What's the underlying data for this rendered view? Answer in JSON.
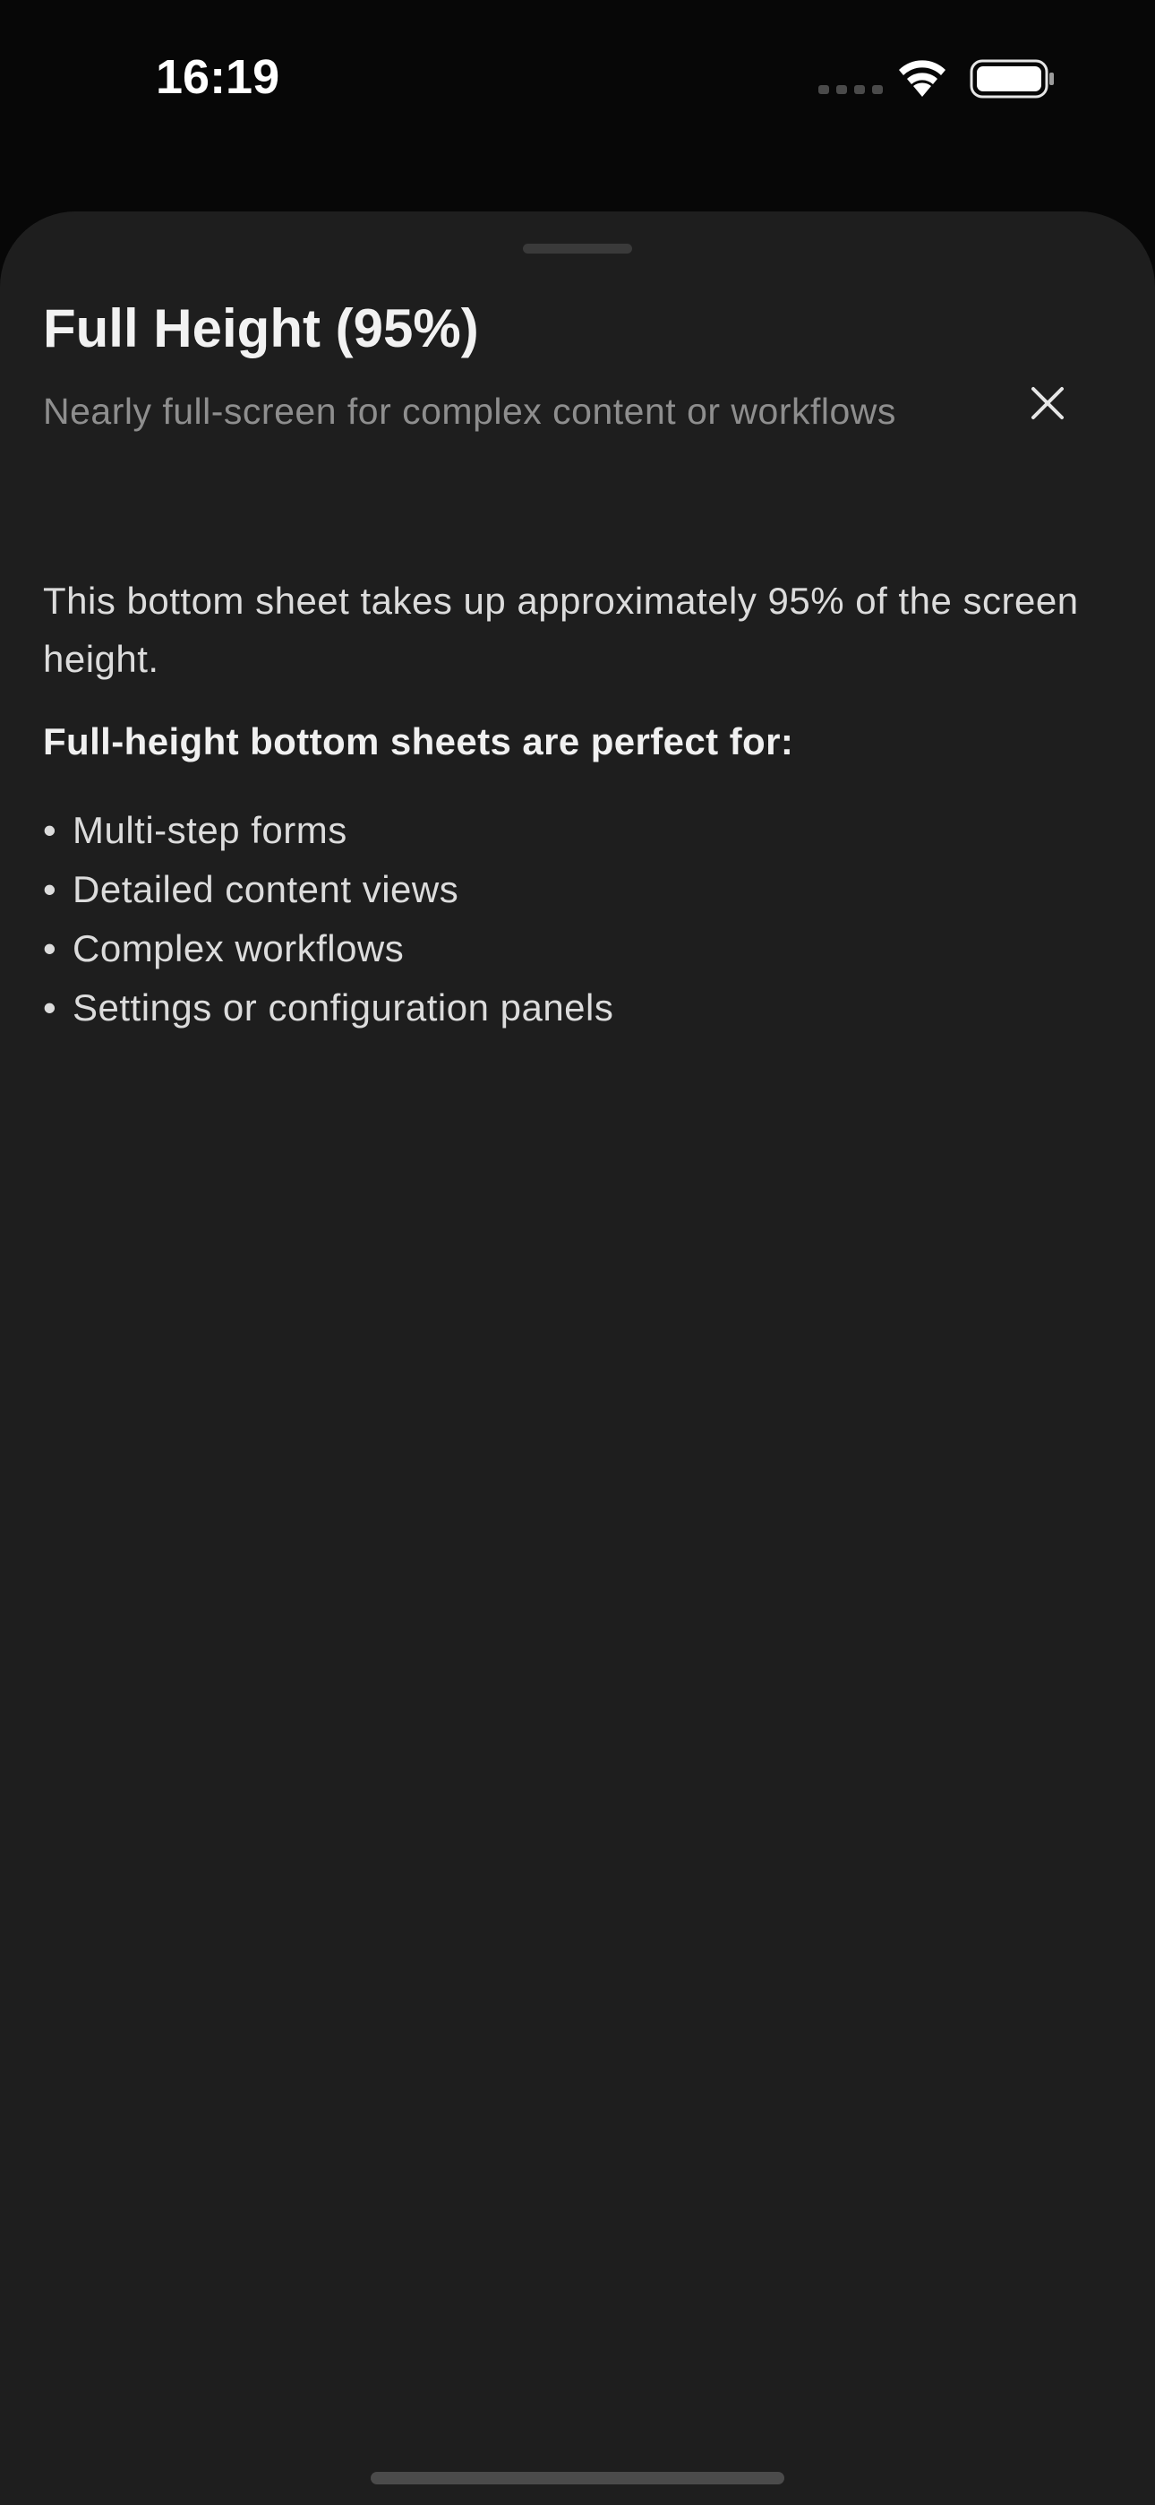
{
  "status_bar": {
    "time": "16:19",
    "signal_icon": "cellular-signal-icon",
    "wifi_icon": "wifi-icon",
    "battery_icon": "battery-icon"
  },
  "sheet": {
    "title": "Full Height (95%)",
    "subtitle": "Nearly full-screen for complex content or workflows",
    "close_icon": "close-icon",
    "description": "This bottom sheet takes up approximately 95% of the screen height.",
    "list_heading": "Full-height bottom sheets are perfect for:",
    "bullet": "•",
    "items": [
      "Multi-step forms",
      "Detailed content views",
      "Complex workflows",
      "Settings or configuration panels"
    ]
  },
  "colors": {
    "screen_background": "#070707",
    "sheet_background": "#1e1e1e",
    "title": "#f2f2f2",
    "subtitle": "#8e8e8e",
    "body_text": "#dcdcdc"
  }
}
